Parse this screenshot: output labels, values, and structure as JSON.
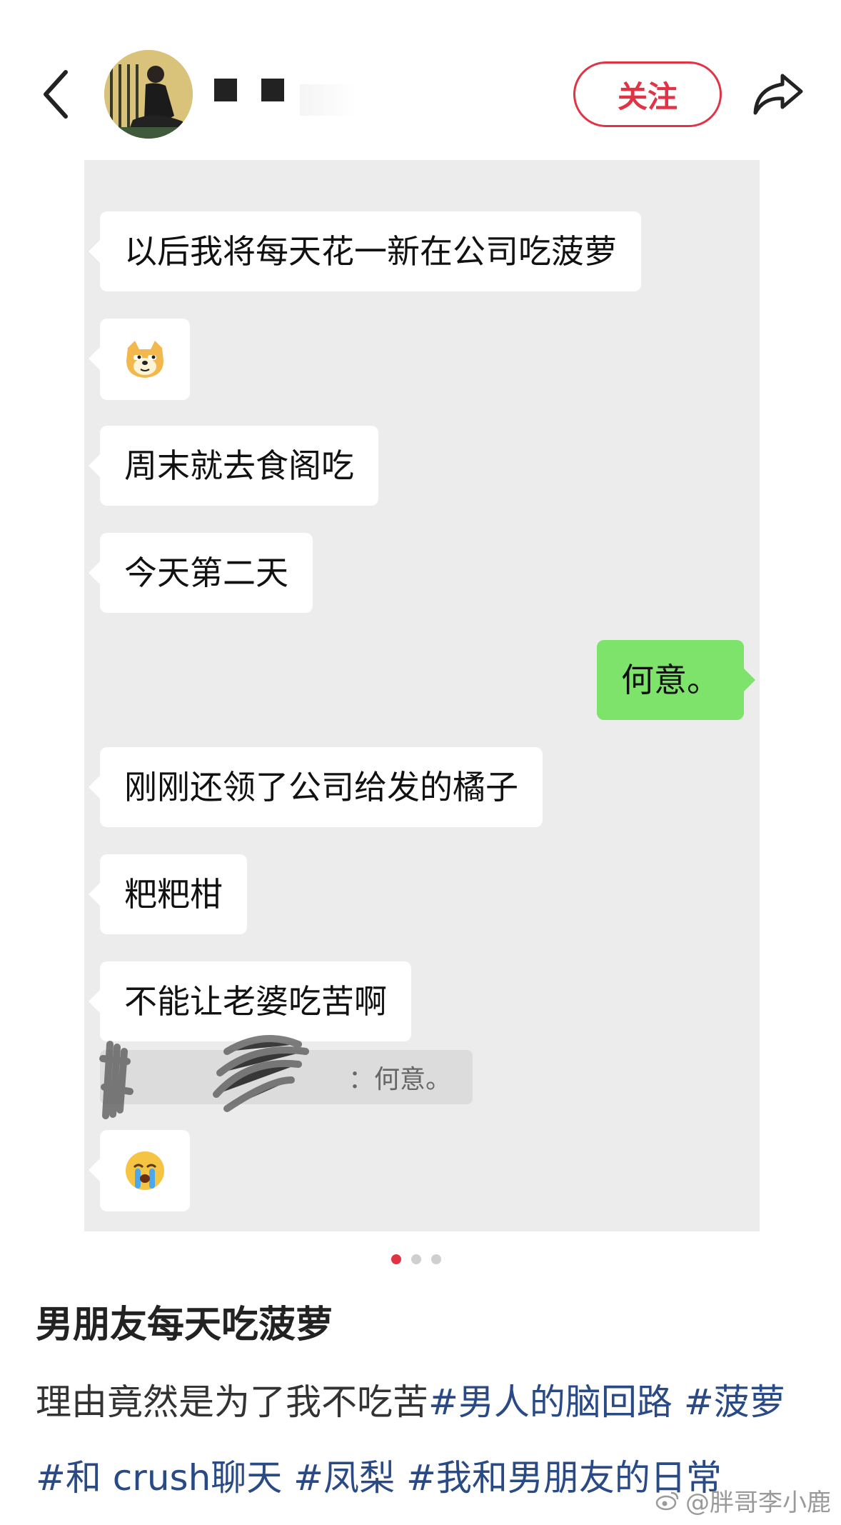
{
  "header": {
    "back_icon": "chevron-left-icon",
    "follow_label": "关注",
    "share_icon": "share-arrow-icon",
    "accent_color": "#e03346"
  },
  "chat": {
    "messages": [
      {
        "side": "left",
        "type": "text",
        "text": "以后我将每天花一新在公司吃菠萝"
      },
      {
        "side": "left",
        "type": "emoji",
        "emoji": "doge-emoji"
      },
      {
        "side": "left",
        "type": "text",
        "text": "周末就去食阁吃"
      },
      {
        "side": "left",
        "type": "text",
        "text": "今天第二天"
      },
      {
        "side": "right",
        "type": "text",
        "text": "何意。"
      },
      {
        "side": "left",
        "type": "text",
        "text": "刚刚还领了公司给发的橘子"
      },
      {
        "side": "left",
        "type": "text",
        "text": "粑粑柑"
      },
      {
        "side": "left",
        "type": "text",
        "text": "不能让老婆吃苦啊"
      },
      {
        "side": "left",
        "type": "emoji",
        "emoji": "crying-emoji"
      }
    ],
    "quote_text": "：何意。",
    "self_bubble_color": "#7ee36a"
  },
  "pager": {
    "count": 3,
    "active": 1
  },
  "post": {
    "title": "男朋友每天吃菠萝",
    "body_plain": "理由竟然是为了我不吃苦",
    "tags": [
      "#男人的脑回路",
      "#菠萝",
      "#和 crush聊天",
      "#凤梨",
      "#我和男朋友的日常"
    ]
  },
  "watermark": "@胖哥李小鹿"
}
